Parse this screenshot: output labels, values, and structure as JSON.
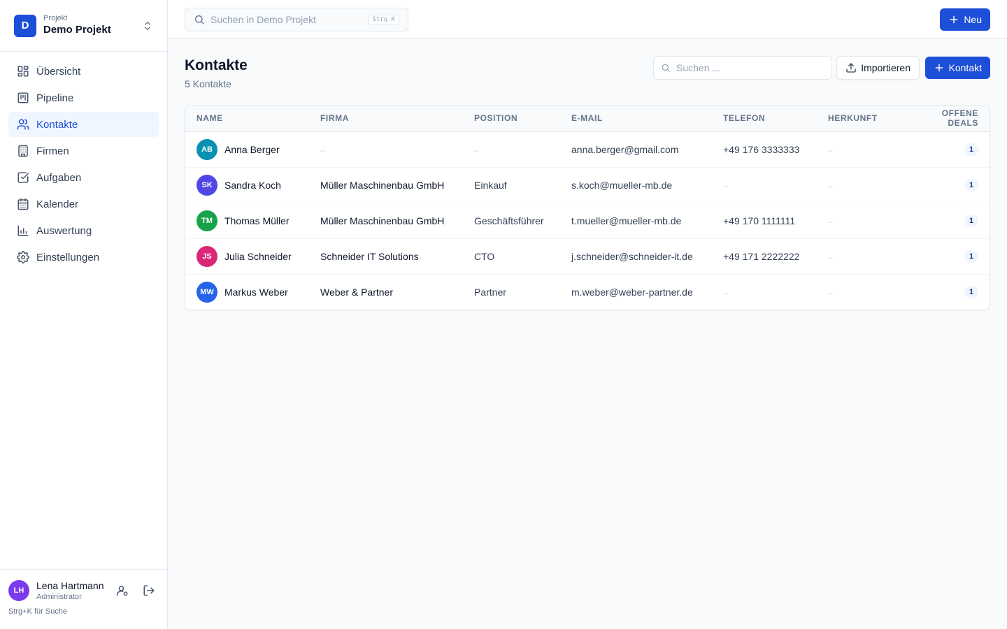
{
  "project": {
    "logo_letter": "D",
    "caption": "Projekt",
    "name": "Demo Projekt"
  },
  "nav": {
    "items": [
      {
        "label": "Übersicht",
        "icon": "dashboard-icon"
      },
      {
        "label": "Pipeline",
        "icon": "pipeline-icon"
      },
      {
        "label": "Kontakte",
        "icon": "users-icon",
        "active": true
      },
      {
        "label": "Firmen",
        "icon": "building-icon"
      },
      {
        "label": "Aufgaben",
        "icon": "checkbox-icon"
      },
      {
        "label": "Kalender",
        "icon": "calendar-icon"
      },
      {
        "label": "Auswertung",
        "icon": "bar-chart-icon"
      },
      {
        "label": "Einstellungen",
        "icon": "gear-icon"
      }
    ]
  },
  "user": {
    "initials": "LH",
    "name": "Lena Hartmann",
    "role": "Administrator",
    "avatar_color": "#7c3aed"
  },
  "hint": "Strg+K für Suche",
  "topbar": {
    "search_placeholder": "Suchen in Demo Projekt",
    "shortcut": "Strg K",
    "new_label": "Neu"
  },
  "page": {
    "title": "Kontakte",
    "subtitle": "5 Kontakte",
    "search_placeholder": "Suchen ...",
    "import_label": "Importieren",
    "add_label": "Kontakt"
  },
  "table": {
    "headers": [
      "NAME",
      "FIRMA",
      "POSITION",
      "E-MAIL",
      "TELEFON",
      "HERKUNFT",
      "OFFENE DEALS"
    ],
    "rows": [
      {
        "initials": "AB",
        "color": "#0891b2",
        "name": "Anna Berger",
        "company": "–",
        "position": "–",
        "email": "anna.berger@gmail.com",
        "phone": "+49 176 3333333",
        "source": "–",
        "deals": "1"
      },
      {
        "initials": "SK",
        "color": "#4f46e5",
        "name": "Sandra Koch",
        "company": "Müller Maschinenbau GmbH",
        "position": "Einkauf",
        "email": "s.koch@mueller-mb.de",
        "phone": "–",
        "source": "–",
        "deals": "1"
      },
      {
        "initials": "TM",
        "color": "#16a34a",
        "name": "Thomas Müller",
        "company": "Müller Maschinenbau GmbH",
        "position": "Geschäftsführer",
        "email": "t.mueller@mueller-mb.de",
        "phone": "+49 170 1111111",
        "source": "–",
        "deals": "1"
      },
      {
        "initials": "JS",
        "color": "#db2777",
        "name": "Julia Schneider",
        "company": "Schneider IT Solutions",
        "position": "CTO",
        "email": "j.schneider@schneider-it.de",
        "phone": "+49 171 2222222",
        "source": "–",
        "deals": "1"
      },
      {
        "initials": "MW",
        "color": "#2563eb",
        "name": "Markus Weber",
        "company": "Weber & Partner",
        "position": "Partner",
        "email": "m.weber@weber-partner.de",
        "phone": "–",
        "source": "–",
        "deals": "1"
      }
    ]
  },
  "colors": {
    "accent": "#1d4ed8",
    "sidebar_active_bg": "#eff6ff"
  }
}
